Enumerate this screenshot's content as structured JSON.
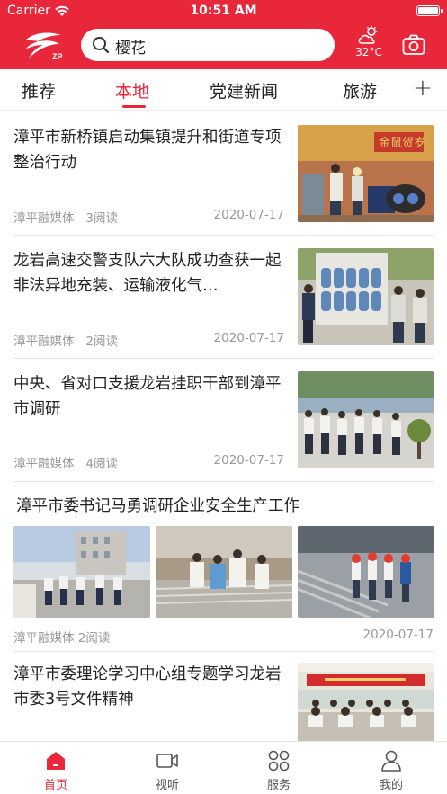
{
  "status_bar": {
    "carrier": "Carrier",
    "time": "10:51 AM"
  },
  "header": {
    "search_text": "樱花",
    "temperature": "32°C",
    "logo_icon": "zp-logo-icon",
    "weather_icon": "partly-cloudy-icon",
    "camera_icon": "camera-icon",
    "accent_color": "#e8283a"
  },
  "tabs": {
    "items": [
      "推荐",
      "本地",
      "党建新闻",
      "旅游"
    ],
    "active_index": 1,
    "add_label": "+"
  },
  "feed": [
    {
      "title": "漳平市新桥镇启动集镇提升和街道专项整治行动",
      "source": "漳平融媒体",
      "reads": "3阅读",
      "date": "2020-07-17"
    },
    {
      "title": "龙岩高速交警支队六大队成功查获一起非法异地充装、运输液化气…",
      "source": "漳平融媒体",
      "reads": "2阅读",
      "date": "2020-07-17"
    },
    {
      "title": "中央、省对口支援龙岩挂职干部到漳平市调研",
      "source": "漳平融媒体",
      "reads": "4阅读",
      "date": "2020-07-17"
    },
    {
      "title": "漳平市委书记马勇调研企业安全生产工作",
      "source": "漳平融媒体 2阅读",
      "date": "2020-07-17"
    },
    {
      "title": "漳平市委理论学习中心组专题学习龙岩市委3号文件精神"
    }
  ],
  "bottom_nav": {
    "items": [
      {
        "label": "首页",
        "icon": "home-icon"
      },
      {
        "label": "视听",
        "icon": "video-icon"
      },
      {
        "label": "服务",
        "icon": "grid-icon"
      },
      {
        "label": "我的",
        "icon": "user-icon"
      }
    ],
    "active_index": 0
  }
}
